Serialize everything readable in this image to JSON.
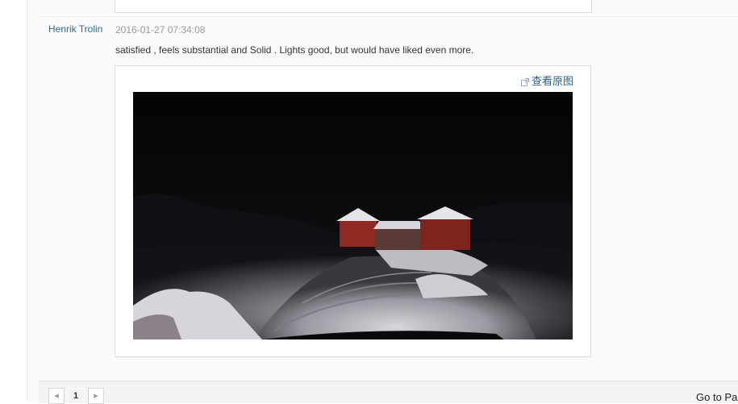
{
  "review": {
    "author": "Henrik Trolin",
    "date": "2016-01-27 07:34:08",
    "text": "satisfied , feels substantial and Solid . Lights good, but would have liked even more.",
    "view_original_label": "查看原图"
  },
  "icons": {
    "external_link": "external-link-icon",
    "prev": "chevron-left-icon",
    "next": "chevron-right-icon"
  },
  "pagination": {
    "prev_symbol": "◂",
    "current_page": "1",
    "next_symbol": "▸",
    "go_to_label": "Go to Pa"
  },
  "colors": {
    "author_link": "#2a6f8f",
    "date_text": "#999999",
    "barn_red": "#8e2a22"
  }
}
